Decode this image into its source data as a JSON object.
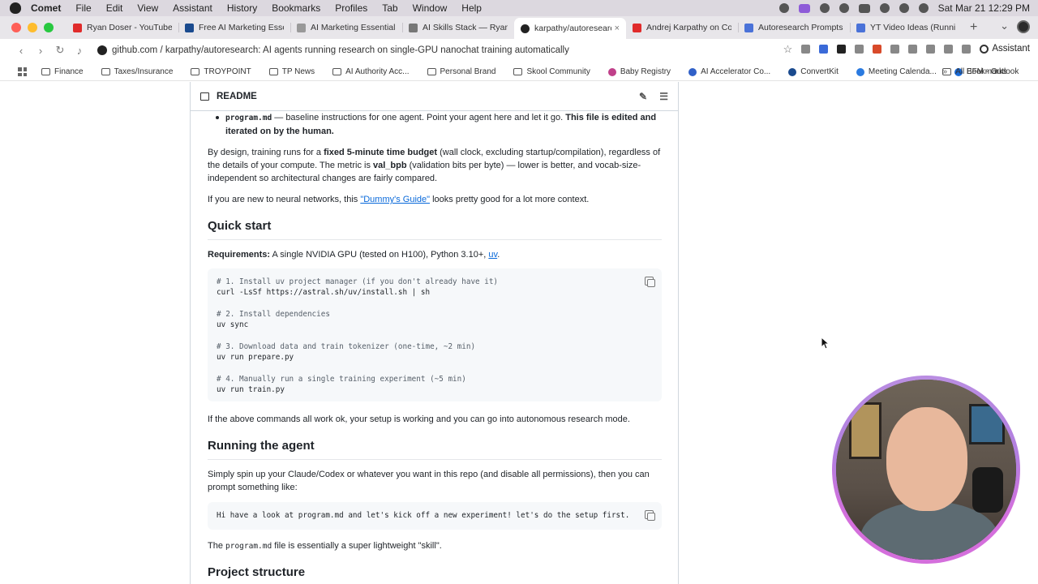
{
  "menubar": {
    "app_name": "Comet",
    "items": [
      "File",
      "Edit",
      "View",
      "Assistant",
      "History",
      "Bookmarks",
      "Profiles",
      "Tab",
      "Window",
      "Help"
    ],
    "clock": "Sat Mar 21  12:29 PM"
  },
  "tabs": [
    {
      "label": "Ryan Doser - YouTube",
      "color": "#e02b2b"
    },
    {
      "label": "Free AI Marketing Essentials",
      "color": "#1a4a8e"
    },
    {
      "label": "AI Marketing Essentials Gu",
      "color": "#888888"
    },
    {
      "label": "AI Skills Stack — Ryan Dose",
      "color": "#777777"
    },
    {
      "label": "karpathy/autoresearch: AI a",
      "color": "#222222",
      "active": true
    },
    {
      "label": "Andrej Karpathy on Code A",
      "color": "#e02b2b"
    },
    {
      "label": "Autoresearch Prompts - Go",
      "color": "#4a72d8"
    },
    {
      "label": "YT Video Ideas (Running Li",
      "color": "#4a72d8"
    }
  ],
  "address": {
    "url": "github.com / karpathy/autoresearch: AI agents running research on single-GPU nanochat training automatically",
    "assistant_label": "Assistant"
  },
  "bookmarks": {
    "items": [
      {
        "label": "Finance",
        "type": "folder"
      },
      {
        "label": "Taxes/Insurance",
        "type": "folder"
      },
      {
        "label": "TROYPOINT",
        "type": "folder"
      },
      {
        "label": "TP News",
        "type": "folder"
      },
      {
        "label": "AI Authority Acc...",
        "type": "folder"
      },
      {
        "label": "Personal Brand",
        "type": "folder"
      },
      {
        "label": "Skool Community",
        "type": "folder"
      },
      {
        "label": "Baby Registry",
        "type": "site",
        "color": "#c0408a"
      },
      {
        "label": "AI Accelerator Co...",
        "type": "site",
        "color": "#3060c8"
      },
      {
        "label": "ConvertKit",
        "type": "site",
        "color": "#1a4a8e"
      },
      {
        "label": "Meeting Calenda...",
        "type": "site",
        "color": "#2a7ae0"
      },
      {
        "label": "EFM - Outlook",
        "type": "site",
        "color": "#1a6ad8"
      }
    ],
    "all_label": "All Bookmarks"
  },
  "readme": {
    "header": "README",
    "bullet_code": "program.md",
    "bullet_text": " — baseline instructions for one agent. Point your agent here and let it go. ",
    "bullet_bold": "This file is edited and iterated on by the human.",
    "p1_a": "By design, training runs for a ",
    "p1_b": "fixed 5-minute time budget",
    "p1_c": " (wall clock, excluding startup/compilation), regardless of the details of your compute. The metric is ",
    "p1_d": "val_bpb",
    "p1_e": " (validation bits per byte) — lower is better, and vocab-size-independent so architectural changes are fairly compared.",
    "p2_a": "If you are new to neural networks, this ",
    "p2_link": "\"Dummy's Guide\"",
    "p2_b": " looks pretty good for a lot more context.",
    "h_quick": "Quick start",
    "req_label": "Requirements:",
    "req_text": " A single NVIDIA GPU (tested on H100), Python 3.10+, ",
    "req_link": "uv",
    "req_end": ".",
    "code1": [
      {
        "t": "# 1. Install uv project manager (if you don't already have it)",
        "c": true
      },
      {
        "t": "curl -LsSf https://astral.sh/uv/install.sh | sh",
        "c": false
      },
      {
        "t": "",
        "c": false
      },
      {
        "t": "# 2. Install dependencies",
        "c": true
      },
      {
        "t": "uv sync",
        "c": false
      },
      {
        "t": "",
        "c": false
      },
      {
        "t": "# 3. Download data and train tokenizer (one-time, ~2 min)",
        "c": true
      },
      {
        "t": "uv run prepare.py",
        "c": false
      },
      {
        "t": "",
        "c": false
      },
      {
        "t": "# 4. Manually run a single training experiment (~5 min)",
        "c": true
      },
      {
        "t": "uv run train.py",
        "c": false
      }
    ],
    "p3": "If the above commands all work ok, your setup is working and you can go into autonomous research mode.",
    "h_running": "Running the agent",
    "p4": "Simply spin up your Claude/Codex or whatever you want in this repo (and disable all permissions), then you can prompt something like:",
    "code2": "Hi have a look at program.md and let's kick off a new experiment! let's do the setup first.",
    "p5_a": "The ",
    "p5_code": "program.md",
    "p5_b": " file is essentially a super lightweight \"skill\".",
    "h_project": "Project structure"
  }
}
